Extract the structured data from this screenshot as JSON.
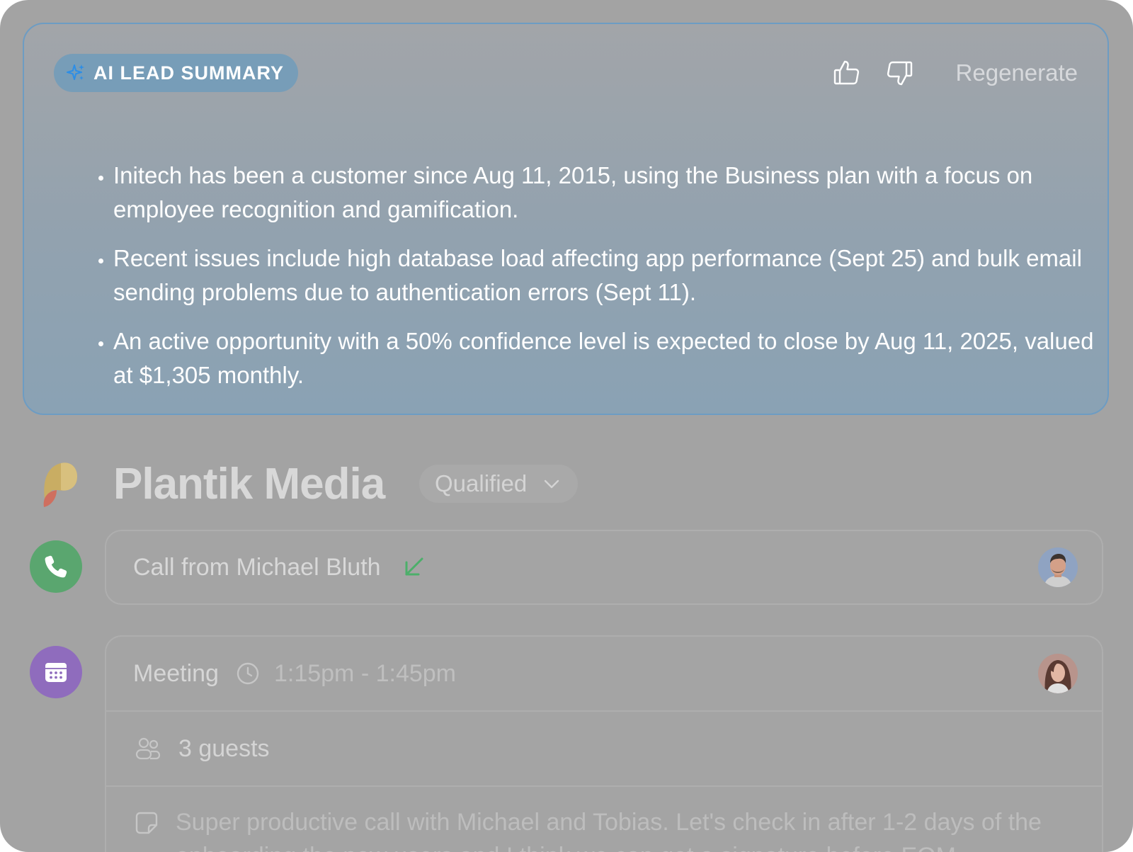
{
  "summary": {
    "badge_label": "AI LEAD SUMMARY",
    "regenerate_label": "Regenerate",
    "bullets": [
      "Initech has been a customer since Aug 11, 2015, using the Business plan with a focus on employee recognition and gamification.",
      "Recent issues include high database load affecting app performance (Sept 25) and bulk email sending problems due to authentication errors (Sept 11).",
      "An active opportunity with a 50% confidence level is expected to close by Aug 11, 2025, valued at $1,305 monthly."
    ]
  },
  "lead": {
    "name": "Plantik Media",
    "status": "Qualified"
  },
  "timeline": {
    "call": {
      "title": "Call from Michael Bluth",
      "direction_icon": "incoming-arrow-icon"
    },
    "meeting": {
      "label": "Meeting",
      "time": "1:15pm - 1:45pm",
      "guests": "3 guests",
      "note": "Super productive call with Michael and Tobias. Let's check in after 1-2 days of the onboarding the new users and I think we can get a signature before EOM."
    }
  },
  "colors": {
    "summary_border": "#6d9cc3",
    "badge_bg": "#779db8",
    "sparkle": "#2d8ee6",
    "call_green": "#5aa66f",
    "meeting_purple": "#8f6cbd"
  }
}
